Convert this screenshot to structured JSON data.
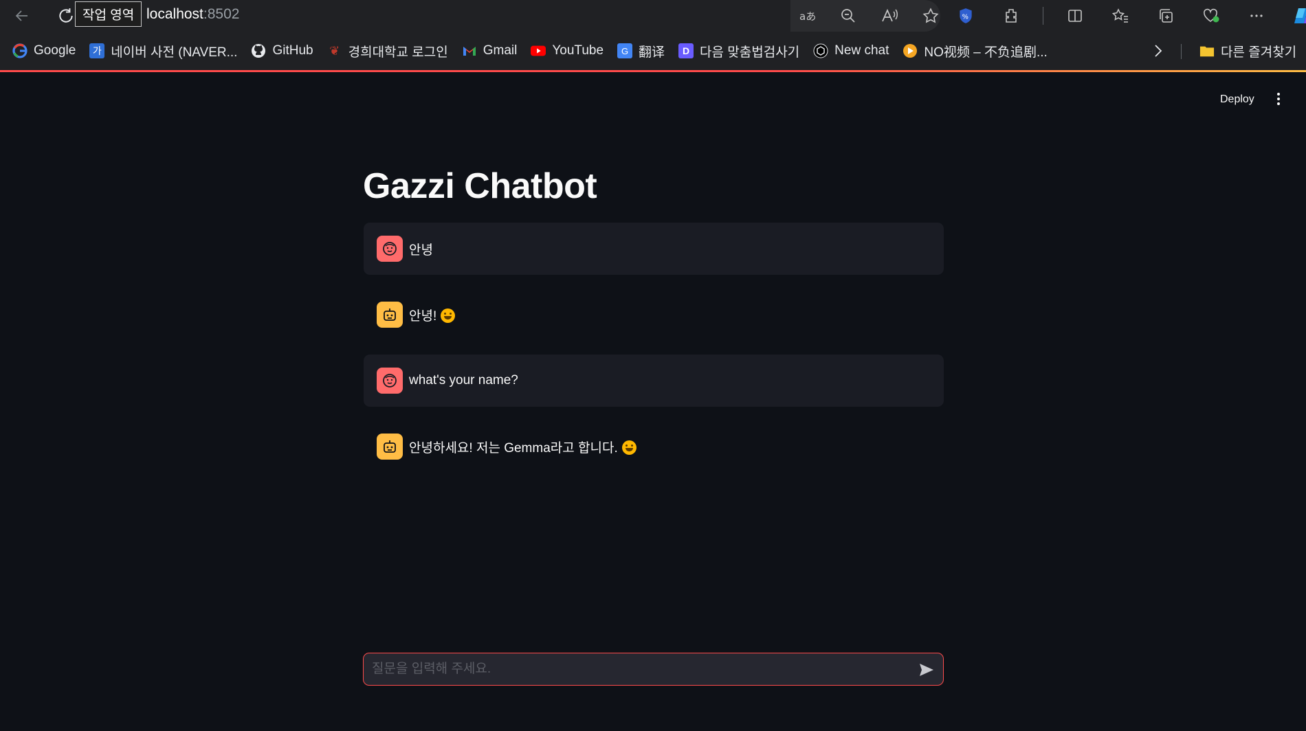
{
  "browser": {
    "tooltip": "작업 영역",
    "address_host": "localhost",
    "address_port": ":8502",
    "bookmarks": [
      {
        "label": "Google",
        "icon": "google-icon"
      },
      {
        "label": "네이버 사전 (NAVER...",
        "icon": "naver-dict-icon"
      },
      {
        "label": "GitHub",
        "icon": "github-icon"
      },
      {
        "label": "경희대학교 로그인",
        "icon": "khu-icon"
      },
      {
        "label": "Gmail",
        "icon": "gmail-icon"
      },
      {
        "label": "YouTube",
        "icon": "youtube-icon"
      },
      {
        "label": "翻译",
        "icon": "translate-icon"
      },
      {
        "label": "다음 맞춤법검사기",
        "icon": "daum-icon"
      },
      {
        "label": "New chat",
        "icon": "openai-icon"
      },
      {
        "label": "NO视频 – 不负追剧...",
        "icon": "novideo-icon"
      }
    ],
    "other_bookmarks": "다른 즐겨찾기"
  },
  "app": {
    "deploy_label": "Deploy",
    "title": "Gazzi Chatbot",
    "messages": [
      {
        "role": "user",
        "text": "안녕"
      },
      {
        "role": "assistant",
        "text": "안녕!"
      },
      {
        "role": "user",
        "text": "what's your name?"
      },
      {
        "role": "assistant",
        "text": "안녕하세요! 저는 Gemma라고 합니다."
      }
    ],
    "input_placeholder": "질문을 입력해 주세요."
  },
  "colors": {
    "background": "#0e1117",
    "user_message_bg": "#1a1c24",
    "user_avatar": "#ff6b6b",
    "assistant_avatar": "#ffbd45",
    "input_border": "#ff4b4b"
  }
}
